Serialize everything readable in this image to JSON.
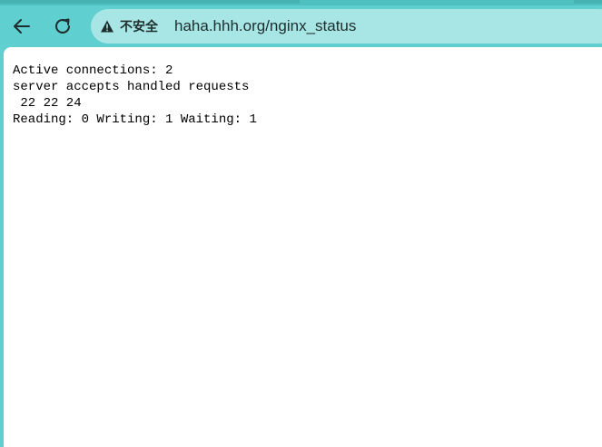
{
  "browser": {
    "address_bar": {
      "security_label": "不安全",
      "url": "haha.hhh.org/nginx_status"
    },
    "colors": {
      "frame": "#5fcfcf",
      "omnibox": "#a8e6e6",
      "icon": "#1e2d2d"
    }
  },
  "page": {
    "lines": [
      "Active connections: 2",
      "server accepts handled requests",
      " 22 22 24",
      "Reading: 0 Writing: 1 Waiting: 1"
    ]
  }
}
